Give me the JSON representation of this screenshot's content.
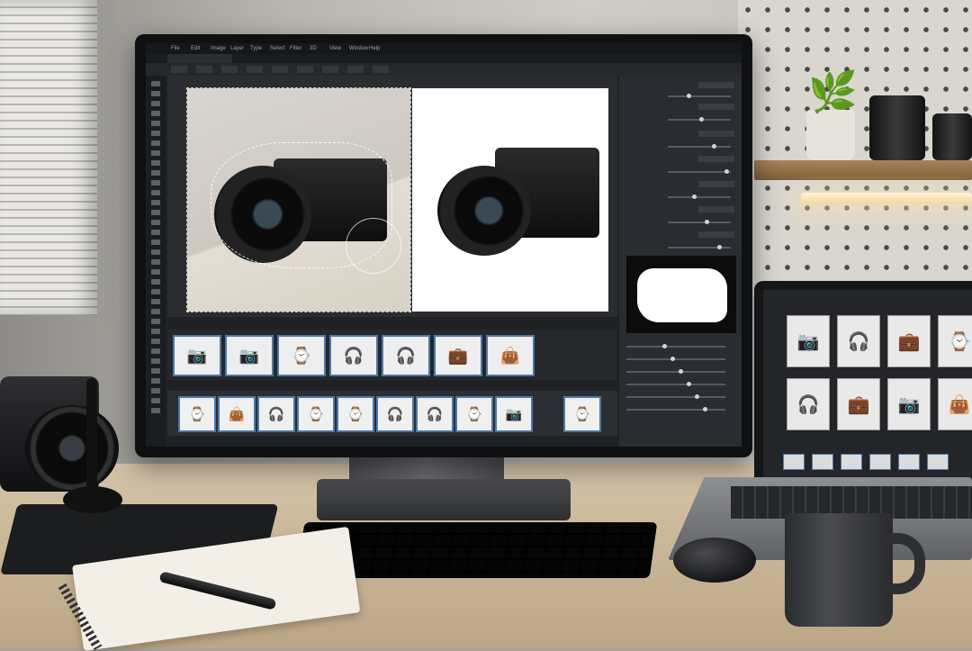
{
  "scene": {
    "description_free": true
  },
  "editor": {
    "menu": [
      "File",
      "Edit",
      "Image",
      "Layer",
      "Type",
      "Select",
      "Filter",
      "3D",
      "View",
      "Window",
      "Help"
    ],
    "tab_label": "",
    "option_buttons": [
      "",
      "",
      "",
      "",
      "",
      "",
      "",
      "",
      ""
    ]
  },
  "icons": {
    "watch": "⌚",
    "camera": "📷",
    "earbuds": "🎧",
    "bag": "👜",
    "case": "💼",
    "plant": "🌿"
  },
  "filmstrip": [
    "camera",
    "camera",
    "watch",
    "earbuds",
    "earbuds",
    "case",
    "bag"
  ],
  "batch_row": [
    "watch",
    "bag",
    "earbuds",
    "watch",
    "watch",
    "earbuds",
    "earbuds",
    "watch",
    "camera",
    "watch"
  ],
  "laptop_grid": [
    "camera",
    "earbuds",
    "case",
    "watch",
    "earbuds",
    "case",
    "camera",
    "bag"
  ],
  "colors": {
    "ui_bg": "#1f2125",
    "panel": "#2a2c31",
    "accent": "#4b78a8"
  }
}
